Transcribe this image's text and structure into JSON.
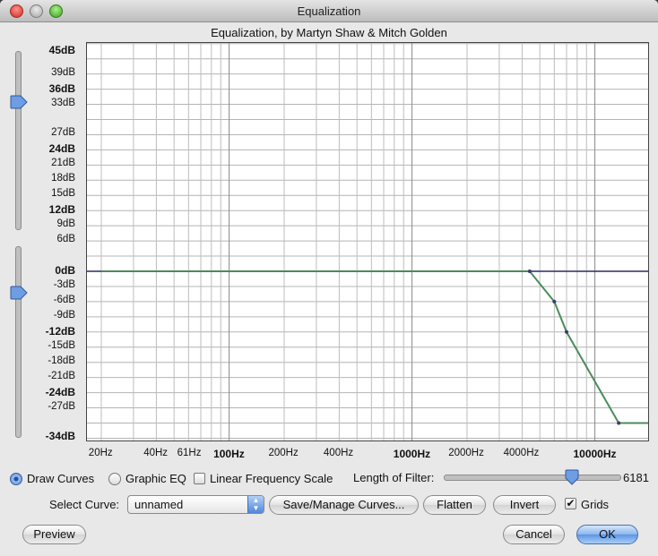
{
  "window": {
    "title": "Equalization",
    "subtitle": "Equalization, by Martyn Shaw & Mitch Golden"
  },
  "y_axis": {
    "labels": [
      {
        "text": "45dB",
        "bold": true
      },
      {
        "text": "39dB",
        "bold": false
      },
      {
        "text": "36dB",
        "bold": true
      },
      {
        "text": "33dB",
        "bold": false
      },
      {
        "text": "27dB",
        "bold": false
      },
      {
        "text": "24dB",
        "bold": true
      },
      {
        "text": "21dB",
        "bold": false
      },
      {
        "text": "18dB",
        "bold": false
      },
      {
        "text": "15dB",
        "bold": false
      },
      {
        "text": "12dB",
        "bold": true
      },
      {
        "text": "9dB",
        "bold": false
      },
      {
        "text": "6dB",
        "bold": false
      },
      {
        "text": "0dB",
        "bold": true
      },
      {
        "text": "-3dB",
        "bold": false
      },
      {
        "text": "-6dB",
        "bold": false
      },
      {
        "text": "-9dB",
        "bold": false
      },
      {
        "text": "-12dB",
        "bold": true
      },
      {
        "text": "-15dB",
        "bold": false
      },
      {
        "text": "-18dB",
        "bold": false
      },
      {
        "text": "-21dB",
        "bold": false
      },
      {
        "text": "-24dB",
        "bold": true
      },
      {
        "text": "-27dB",
        "bold": false
      },
      {
        "text": "-34dB",
        "bold": true
      }
    ]
  },
  "x_axis": {
    "labels": [
      {
        "text": "20Hz",
        "bold": false
      },
      {
        "text": "40Hz",
        "bold": false
      },
      {
        "text": "61Hz",
        "bold": false
      },
      {
        "text": "100Hz",
        "bold": true
      },
      {
        "text": "200Hz",
        "bold": false
      },
      {
        "text": "400Hz",
        "bold": false
      },
      {
        "text": "1000Hz",
        "bold": true
      },
      {
        "text": "2000Hz",
        "bold": false
      },
      {
        "text": "4000Hz",
        "bold": false
      },
      {
        "text": "10000Hz",
        "bold": true
      }
    ]
  },
  "curve": {
    "points_hz_db": [
      [
        20,
        0
      ],
      [
        4400,
        0
      ],
      [
        6000,
        -6
      ],
      [
        7000,
        -12
      ],
      [
        13500,
        -30
      ],
      [
        20000,
        -30
      ]
    ],
    "color": "#4a8c5a"
  },
  "controls": {
    "draw_curves_label": "Draw Curves",
    "graphic_eq_label": "Graphic EQ",
    "linear_scale_label": "Linear Frequency Scale",
    "length_of_filter_label": "Length of Filter:",
    "length_of_filter_value": "6181",
    "length_of_filter_fraction": 0.73,
    "select_curve_label": "Select Curve:",
    "select_curve_value": "unnamed",
    "save_manage_label": "Save/Manage Curves...",
    "flatten_label": "Flatten",
    "invert_label": "Invert",
    "grids_label": "Grids",
    "grids_checked": true,
    "draw_curves_selected": true
  },
  "footer": {
    "preview_label": "Preview",
    "cancel_label": "Cancel",
    "ok_label": "OK"
  },
  "colors": {
    "accent": "#4f86da",
    "curve": "#4a8c5a",
    "zero_line": "#2a2a6a"
  }
}
